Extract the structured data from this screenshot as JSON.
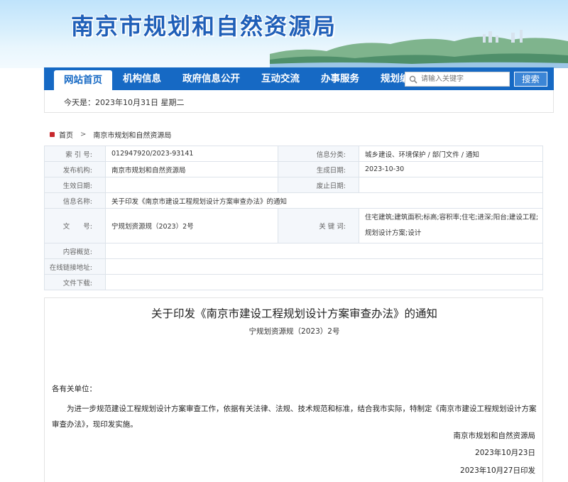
{
  "site": {
    "title": "南京市规划和自然资源局",
    "accent_color": "#1669c4"
  },
  "nav": {
    "items": [
      {
        "label": "网站首页",
        "active": true
      },
      {
        "label": "机构信息"
      },
      {
        "label": "政府信息公开"
      },
      {
        "label": "互动交流"
      },
      {
        "label": "办事服务"
      },
      {
        "label": "规划编制"
      }
    ],
    "search_placeholder": "请输入关键字",
    "search_button": "搜索",
    "search_icon": "magnifier-icon"
  },
  "today": "今天是：2023年10月31日 星期二",
  "breadcrumb": {
    "home": "首页",
    "separator": ">",
    "current": "南京市规划和自然资源局"
  },
  "info": {
    "index_label": "索 引 号:",
    "index_value": "012947920/2023-93141",
    "category_label": "信息分类:",
    "category_value": "城乡建设、环境保护 / 部门文件 / 通知",
    "publisher_label": "发布机构:",
    "publisher_value": "南京市规划和自然资源局",
    "created_label": "生成日期:",
    "created_value": "2023-10-30",
    "effective_label": "生效日期:",
    "effective_value": "",
    "expiry_label": "废止日期:",
    "expiry_value": "",
    "name_label": "信息名称:",
    "name_value": "关于印发《南京市建设工程规划设计方案审查办法》的通知",
    "doc_no_label": "文　　号:",
    "doc_no_value": "宁规划资源规（2023）2号",
    "keywords_label": "关 键 词:",
    "keywords_value": "住宅建筑;建筑面积;标高;容积率;住宅;进深;阳台;建设工程;规划设计方案;设计",
    "overview_label": "内容概览:",
    "overview_value": "",
    "online_label": "在线链接地址:",
    "online_value": "",
    "download_label": "文件下载:",
    "download_value": ""
  },
  "document": {
    "title": "关于印发《南京市建设工程规划设计方案审查办法》的通知",
    "number": "宁规划资源规（2023）2号",
    "salutation": "各有关单位：",
    "paragraph": "为进一步规范建设工程规划设计方案审查工作，依据有关法律、法规、技术规范和标准，结合我市实际，特制定《南京市建设工程规划设计方案审查办法》，现印发实施。",
    "signer": "南京市规划和自然资源局",
    "sign_date": "2023年10月23日",
    "print_date": "2023年10月27日印发"
  }
}
